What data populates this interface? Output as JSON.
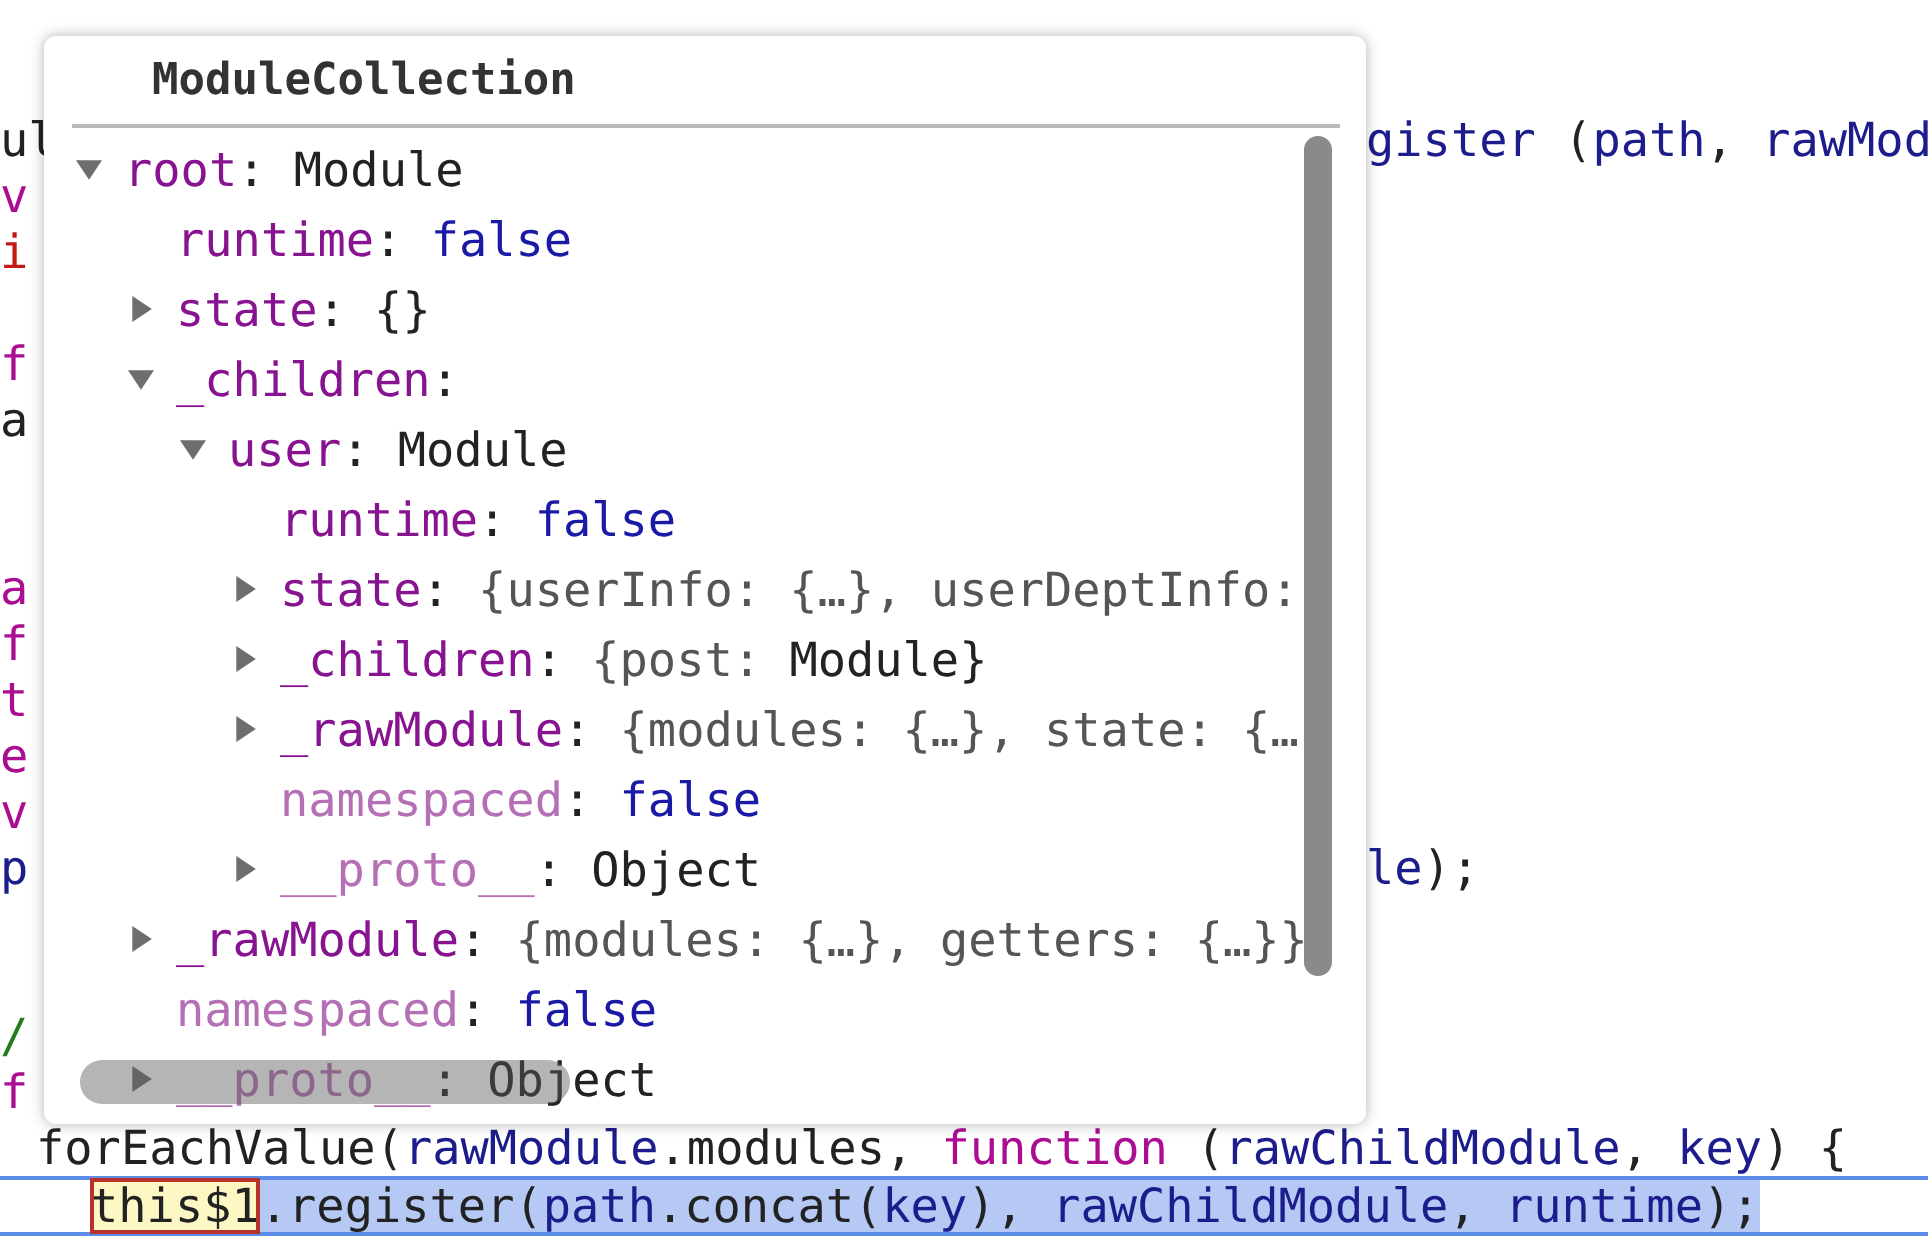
{
  "code_lines": [
    {
      "kind": "fragment",
      "left": [
        {
          "text": "ul",
          "kind": "plain"
        }
      ],
      "right": [
        {
          "text": "gister",
          "kind": "variable"
        },
        {
          "text": " (",
          "kind": "plain"
        },
        {
          "text": "path",
          "kind": "variable"
        },
        {
          "text": ", ",
          "kind": "plain"
        },
        {
          "text": "rawMod",
          "kind": "variable"
        }
      ]
    },
    {
      "kind": "fragment",
      "left": [
        {
          "text": "v",
          "kind": "keyword"
        }
      ]
    },
    {
      "kind": "fragment",
      "left": [
        {
          "text": "i",
          "kind": "string"
        }
      ]
    },
    {
      "kind": "blank"
    },
    {
      "kind": "fragment",
      "left": [
        {
          "text": "f",
          "kind": "keyword"
        }
      ]
    },
    {
      "kind": "fragment",
      "left": [
        {
          "text": "a",
          "kind": "plain"
        }
      ]
    },
    {
      "kind": "blank"
    },
    {
      "kind": "blank"
    },
    {
      "kind": "fragment",
      "left": [
        {
          "text": "a",
          "kind": "keyword"
        }
      ]
    },
    {
      "kind": "fragment",
      "left": [
        {
          "text": "f",
          "kind": "keyword"
        }
      ]
    },
    {
      "kind": "fragment",
      "left": [
        {
          "text": "t",
          "kind": "keyword"
        }
      ]
    },
    {
      "kind": "fragment",
      "left": [
        {
          "text": "e",
          "kind": "keyword"
        }
      ]
    },
    {
      "kind": "fragment",
      "left": [
        {
          "text": "v",
          "kind": "keyword"
        }
      ]
    },
    {
      "kind": "fragment",
      "left": [
        {
          "text": "p",
          "kind": "variable"
        }
      ],
      "right": [
        {
          "text": "le",
          "kind": "variable"
        },
        {
          "text": ");",
          "kind": "plain"
        }
      ]
    },
    {
      "kind": "blank"
    },
    {
      "kind": "blank"
    },
    {
      "kind": "fragment",
      "left": [
        {
          "text": "/",
          "kind": "comment"
        }
      ]
    },
    {
      "kind": "fragment",
      "left": [
        {
          "text": "f",
          "kind": "keyword"
        }
      ]
    },
    {
      "kind": "statement",
      "tokens": [
        {
          "text": "forEachValue(",
          "kind": "plain"
        },
        {
          "text": "rawModule",
          "kind": "variable"
        },
        {
          "text": ".modules, ",
          "kind": "plain"
        },
        {
          "text": "function",
          "kind": "keyword"
        },
        {
          "text": " (",
          "kind": "plain"
        },
        {
          "text": "rawChildModule",
          "kind": "variable"
        },
        {
          "text": ", ",
          "kind": "plain"
        },
        {
          "text": "key",
          "kind": "variable"
        },
        {
          "text": ") {",
          "kind": "plain"
        }
      ]
    },
    {
      "kind": "current",
      "tokens": [
        {
          "text": "this$1",
          "kind": "match"
        },
        {
          "text": ".register(",
          "kind": "plain"
        },
        {
          "text": "path",
          "kind": "variable"
        },
        {
          "text": ".concat(",
          "kind": "plain"
        },
        {
          "text": "key",
          "kind": "variable"
        },
        {
          "text": "), ",
          "kind": "plain"
        },
        {
          "text": "rawChildModule",
          "kind": "variable"
        },
        {
          "text": ", ",
          "kind": "plain"
        },
        {
          "text": "runtime",
          "kind": "variable"
        },
        {
          "text": ");",
          "kind": "plain"
        }
      ]
    }
  ],
  "popover": {
    "title": "ModuleCollection",
    "tree": [
      {
        "kind": "node",
        "expanded": true,
        "tokens": [
          {
            "text": "root",
            "kind": "key"
          },
          {
            "text": ": Module",
            "kind": "plain"
          }
        ],
        "children": [
          {
            "kind": "leaf",
            "tokens": [
              {
                "text": "runtime",
                "kind": "key"
              },
              {
                "text": ": ",
                "kind": "plain"
              },
              {
                "text": "false",
                "kind": "boolean"
              }
            ]
          },
          {
            "kind": "node",
            "expanded": false,
            "tokens": [
              {
                "text": "state",
                "kind": "key"
              },
              {
                "text": ": {}",
                "kind": "plain"
              }
            ]
          },
          {
            "kind": "node",
            "expanded": true,
            "tokens": [
              {
                "text": "_children",
                "kind": "key"
              },
              {
                "text": ":",
                "kind": "plain"
              }
            ],
            "children": [
              {
                "kind": "node",
                "expanded": true,
                "tokens": [
                  {
                    "text": "user",
                    "kind": "key"
                  },
                  {
                    "text": ": Module",
                    "kind": "plain"
                  }
                ],
                "children": [
                  {
                    "kind": "leaf",
                    "tokens": [
                      {
                        "text": "runtime",
                        "kind": "key"
                      },
                      {
                        "text": ": ",
                        "kind": "plain"
                      },
                      {
                        "text": "false",
                        "kind": "boolean"
                      }
                    ]
                  },
                  {
                    "kind": "node",
                    "expanded": false,
                    "tokens": [
                      {
                        "text": "state",
                        "kind": "key"
                      },
                      {
                        "text": ": ",
                        "kind": "plain"
                      },
                      {
                        "text": "{userInfo: {…}, userDeptInfo:",
                        "kind": "preview"
                      }
                    ]
                  },
                  {
                    "kind": "node",
                    "expanded": false,
                    "tokens": [
                      {
                        "text": "_children",
                        "kind": "key"
                      },
                      {
                        "text": ": ",
                        "kind": "plain"
                      },
                      {
                        "text": "{post: ",
                        "kind": "preview"
                      },
                      {
                        "text": "Module}",
                        "kind": "plain"
                      }
                    ]
                  },
                  {
                    "kind": "node",
                    "expanded": false,
                    "tokens": [
                      {
                        "text": "_rawModule",
                        "kind": "key"
                      },
                      {
                        "text": ": ",
                        "kind": "plain"
                      },
                      {
                        "text": "{modules: {…}, state: {…",
                        "kind": "preview"
                      }
                    ]
                  },
                  {
                    "kind": "leaf",
                    "tokens": [
                      {
                        "text": "namespaced",
                        "kind": "key_dim"
                      },
                      {
                        "text": ": ",
                        "kind": "plain"
                      },
                      {
                        "text": "false",
                        "kind": "boolean"
                      }
                    ]
                  },
                  {
                    "kind": "node",
                    "expanded": false,
                    "tokens": [
                      {
                        "text": "__proto__",
                        "kind": "key_dim"
                      },
                      {
                        "text": ": Object",
                        "kind": "plain"
                      }
                    ]
                  }
                ]
              }
            ]
          },
          {
            "kind": "node",
            "expanded": false,
            "tokens": [
              {
                "text": "_rawModule",
                "kind": "key"
              },
              {
                "text": ": ",
                "kind": "plain"
              },
              {
                "text": "{modules: {…}, getters: {…}}",
                "kind": "preview"
              }
            ]
          },
          {
            "kind": "leaf",
            "tokens": [
              {
                "text": "namespaced",
                "kind": "key_dim"
              },
              {
                "text": ": ",
                "kind": "plain"
              },
              {
                "text": "false",
                "kind": "boolean"
              }
            ]
          },
          {
            "kind": "node",
            "expanded": false,
            "tokens": [
              {
                "text": "__proto__",
                "kind": "key_dim"
              },
              {
                "text": ": Object",
                "kind": "plain"
              }
            ]
          }
        ]
      }
    ]
  }
}
